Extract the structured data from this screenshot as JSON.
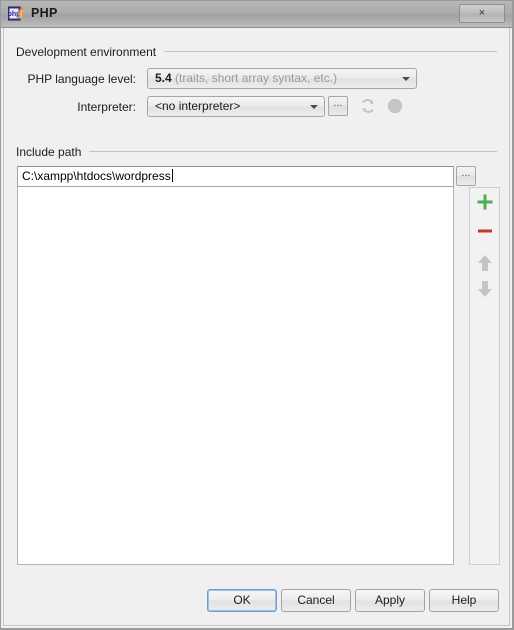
{
  "window": {
    "title": "PHP",
    "icon": "php-logo-icon",
    "close_label": "×"
  },
  "sections": {
    "development_environment": {
      "title": "Development environment",
      "php_language_level": {
        "label": "PHP language level:",
        "value": "5.4",
        "hint": "(traits, short array syntax, etc.)"
      },
      "interpreter": {
        "label": "Interpreter:",
        "value": "<no interpreter>",
        "browse_label": "...",
        "refresh_icon": "refresh-icon",
        "status_icon": "status-dot-icon"
      }
    },
    "include_path": {
      "title": "Include path",
      "path_value": "C:\\xampp\\htdocs\\wordpress",
      "browse_label": "...",
      "toolbar": {
        "add_label": "+",
        "remove_label": "−",
        "move_up_label": "▲",
        "move_down_label": "▼"
      },
      "entries": []
    }
  },
  "footer": {
    "ok_label": "OK",
    "cancel_label": "Cancel",
    "apply_label": "Apply",
    "help_label": "Help"
  },
  "colors": {
    "accent_add": "#4caf50",
    "accent_remove": "#c0392b",
    "focus_border": "#6f9fd0",
    "dialog_bg": "#f0f0f0"
  }
}
